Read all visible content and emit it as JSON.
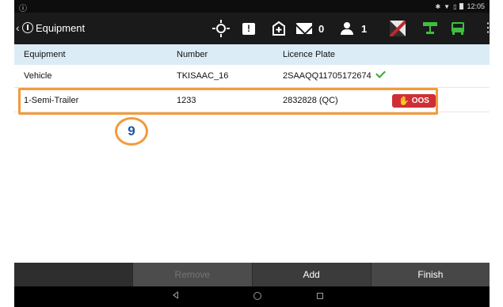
{
  "status_bar": {
    "time": "12:05",
    "left_icon": "info-icon"
  },
  "header": {
    "back_glyph": "‹",
    "title": "Equipment",
    "message_count": "0",
    "driver_count": "1"
  },
  "table": {
    "columns": [
      "Equipment",
      "Number",
      "Licence Plate"
    ],
    "rows": [
      {
        "equipment": "Vehicle",
        "number": "TKISAAC_16",
        "plate": "2SAAQQ11705172674",
        "status": "ok"
      },
      {
        "equipment": "1-Semi-Trailer",
        "number": "1233",
        "plate": "2832828 (QC)",
        "status": "OOS"
      }
    ]
  },
  "annotation": {
    "callout_number": "9"
  },
  "actions": {
    "remove": "Remove",
    "add": "Add",
    "finish": "Finish"
  },
  "colors": {
    "highlight": "#f39a3c",
    "oos": "#cf2e36",
    "check": "#3aa63a",
    "header_bg": "#dcecf7",
    "icon_green": "#3fbf3f"
  }
}
